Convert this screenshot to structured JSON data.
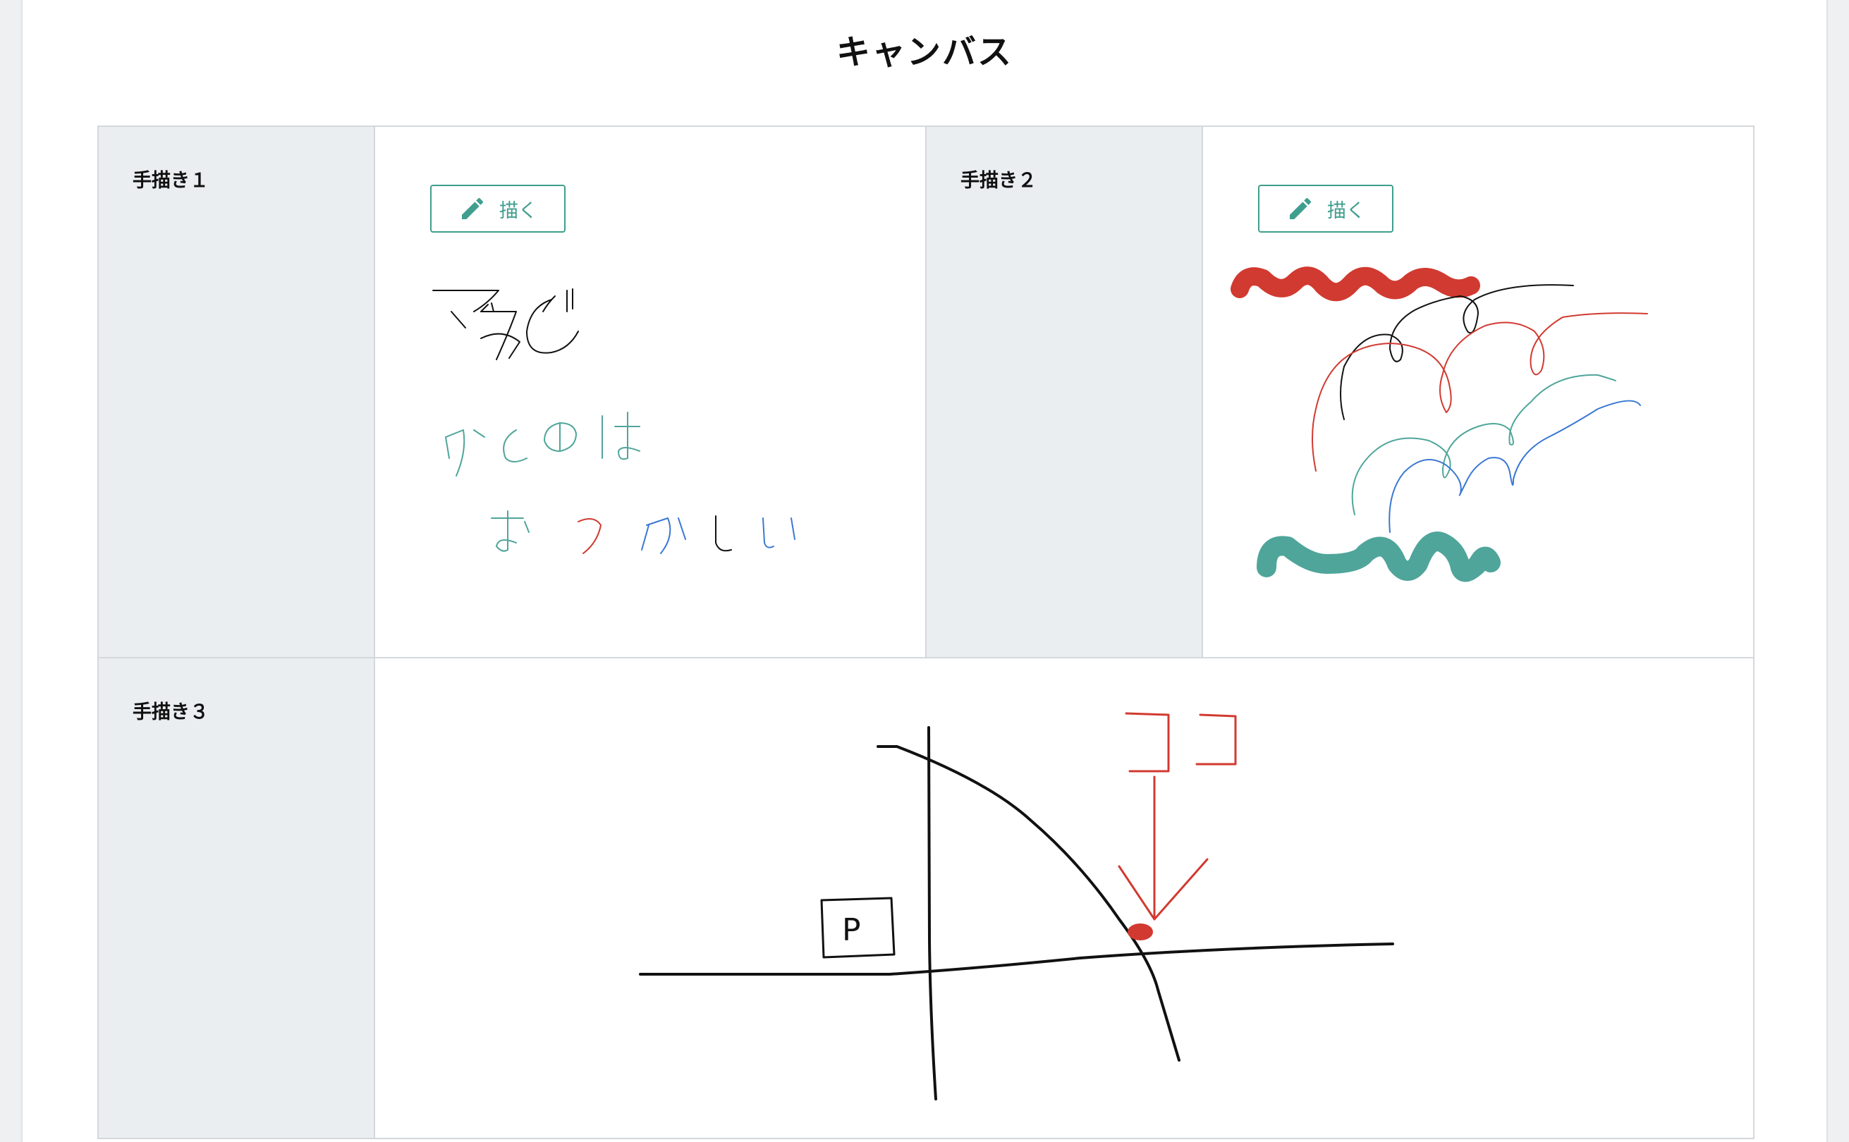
{
  "page": {
    "title": "キャンバス"
  },
  "fields": [
    {
      "label": "手描き１",
      "button_label": "描く",
      "icon": "pencil-icon"
    },
    {
      "label": "手描き２",
      "button_label": "描く",
      "icon": "pencil-icon"
    },
    {
      "label": "手描き３"
    }
  ],
  "drawing_map": {
    "parking_sign": "P"
  },
  "colors": {
    "accent": "#3f9e8e",
    "ink_black": "#111111",
    "ink_red": "#d13a30",
    "ink_teal": "#4fa59a",
    "ink_blue": "#3a78d4",
    "label_bg": "#eaeef1",
    "border": "#d4d8dc"
  }
}
